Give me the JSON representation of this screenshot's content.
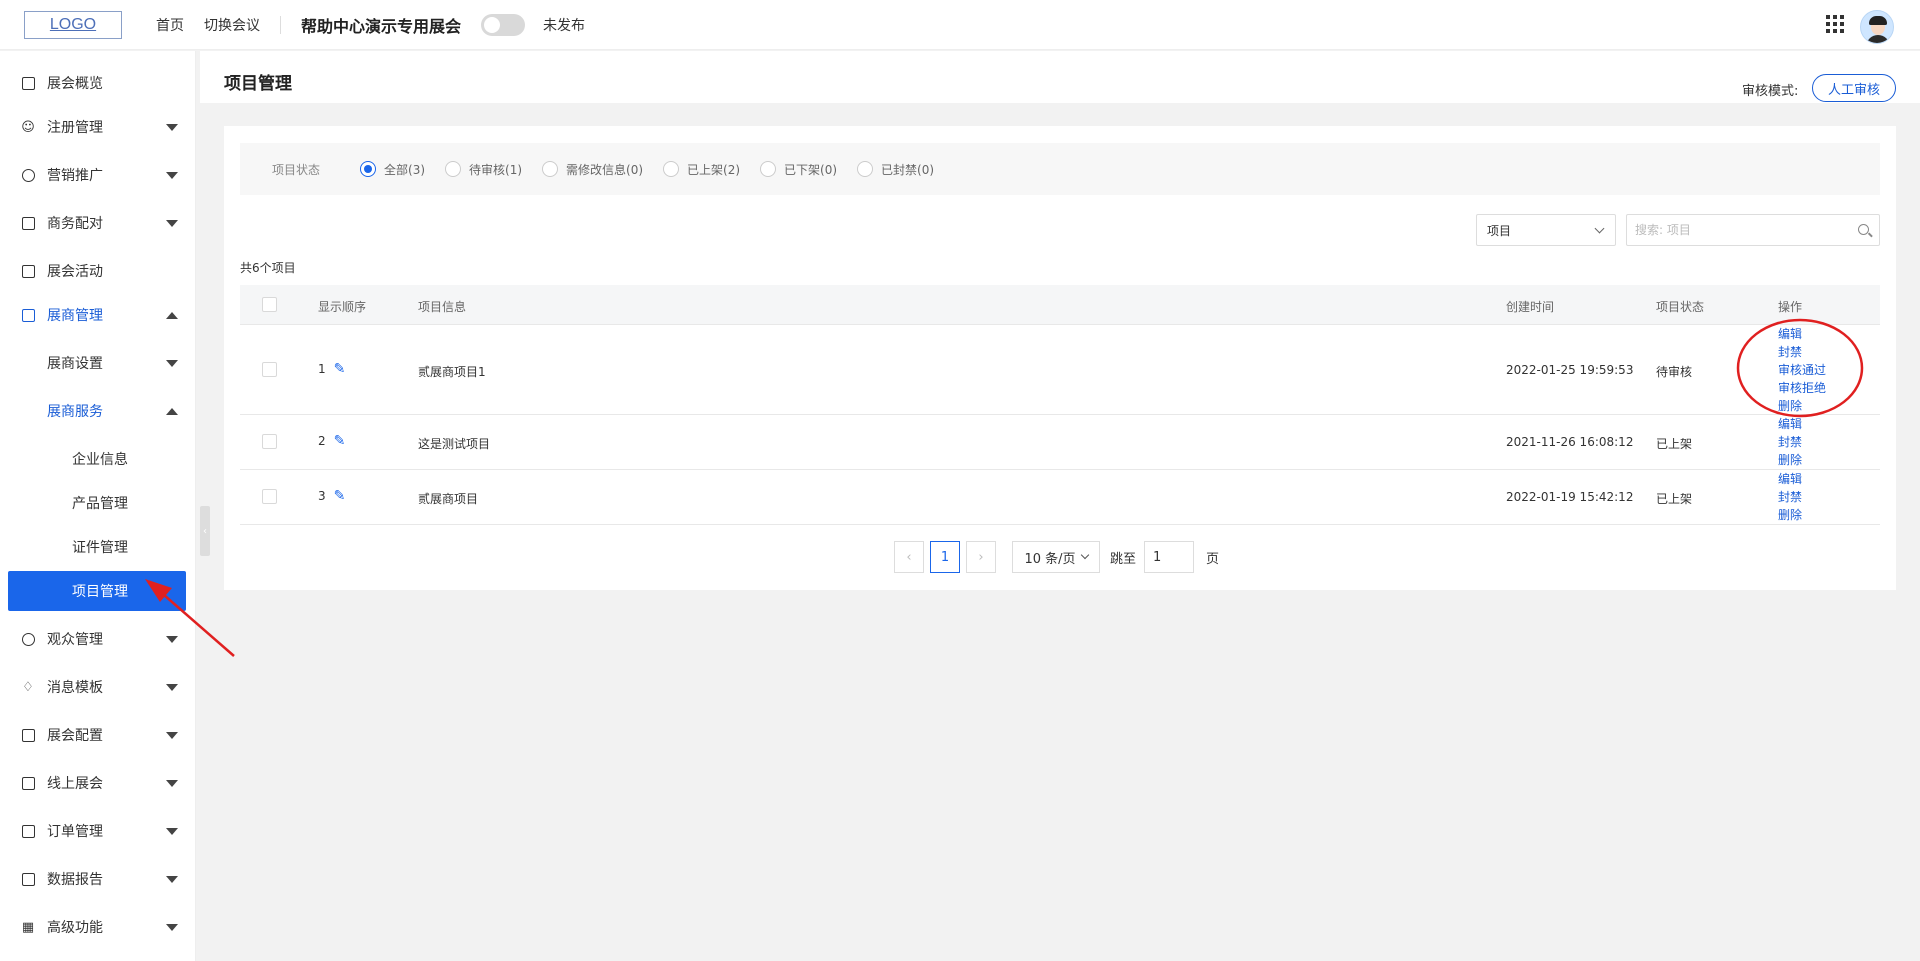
{
  "header": {
    "logo": "LOGO",
    "nav": [
      "首页",
      "切换会议"
    ],
    "event_title": "帮助中心演示专用展会",
    "publish_status": "未发布"
  },
  "sidebar": {
    "items": [
      {
        "label": "展会概览",
        "icon": "overview-icon"
      },
      {
        "label": "注册管理",
        "icon": "user-icon"
      },
      {
        "label": "营销推广",
        "icon": "chart-pie-icon"
      },
      {
        "label": "商务配对",
        "icon": "match-icon"
      },
      {
        "label": "展会活动",
        "icon": "bookmark-icon"
      },
      {
        "label": "展商管理",
        "icon": "store-icon"
      },
      {
        "label": "展商设置"
      },
      {
        "label": "展商服务"
      },
      {
        "label": "企业信息"
      },
      {
        "label": "产品管理"
      },
      {
        "label": "证件管理"
      },
      {
        "label": "项目管理"
      },
      {
        "label": "观众管理",
        "icon": "database-icon"
      },
      {
        "label": "消息模板",
        "icon": "bell-icon"
      },
      {
        "label": "展会配置",
        "icon": "config-icon"
      },
      {
        "label": "线上展会",
        "icon": "monitor-icon"
      },
      {
        "label": "订单管理",
        "icon": "order-icon"
      },
      {
        "label": "数据报告",
        "icon": "report-icon"
      },
      {
        "label": "高级功能",
        "icon": "grid-icon"
      }
    ]
  },
  "page": {
    "title": "项目管理",
    "review_mode_label": "审核模式:",
    "review_mode_value": "人工审核"
  },
  "filter": {
    "label": "项目状态",
    "options": [
      "全部(3)",
      "待审核(1)",
      "需修改信息(0)",
      "已上架(2)",
      "已下架(0)",
      "已封禁(0)"
    ],
    "selected": 0
  },
  "search": {
    "select_value": "项目",
    "placeholder": "搜索: 项目"
  },
  "total_text": "共6个项目",
  "table": {
    "columns": [
      "显示顺序",
      "项目信息",
      "创建时间",
      "项目状态",
      "操作"
    ],
    "rows": [
      {
        "order": "1",
        "name": "贰展商项目1",
        "created": "2022-01-25 19:59:53",
        "status": "待审核",
        "ops": [
          "编辑",
          "封禁",
          "审核通过",
          "审核拒绝",
          "删除"
        ]
      },
      {
        "order": "2",
        "name": "这是测试项目",
        "created": "2021-11-26 16:08:12",
        "status": "已上架",
        "ops": [
          "编辑",
          "封禁",
          "删除"
        ]
      },
      {
        "order": "3",
        "name": "贰展商项目",
        "created": "2022-01-19 15:42:12",
        "status": "已上架",
        "ops": [
          "编辑",
          "封禁",
          "删除"
        ]
      }
    ]
  },
  "pager": {
    "current": "1",
    "page_size": "10 条/页",
    "jump_label": "跳至",
    "jump_value": "1",
    "unit": "页"
  },
  "colors": {
    "primary": "#1a66ea",
    "annotation": "#e02020"
  }
}
